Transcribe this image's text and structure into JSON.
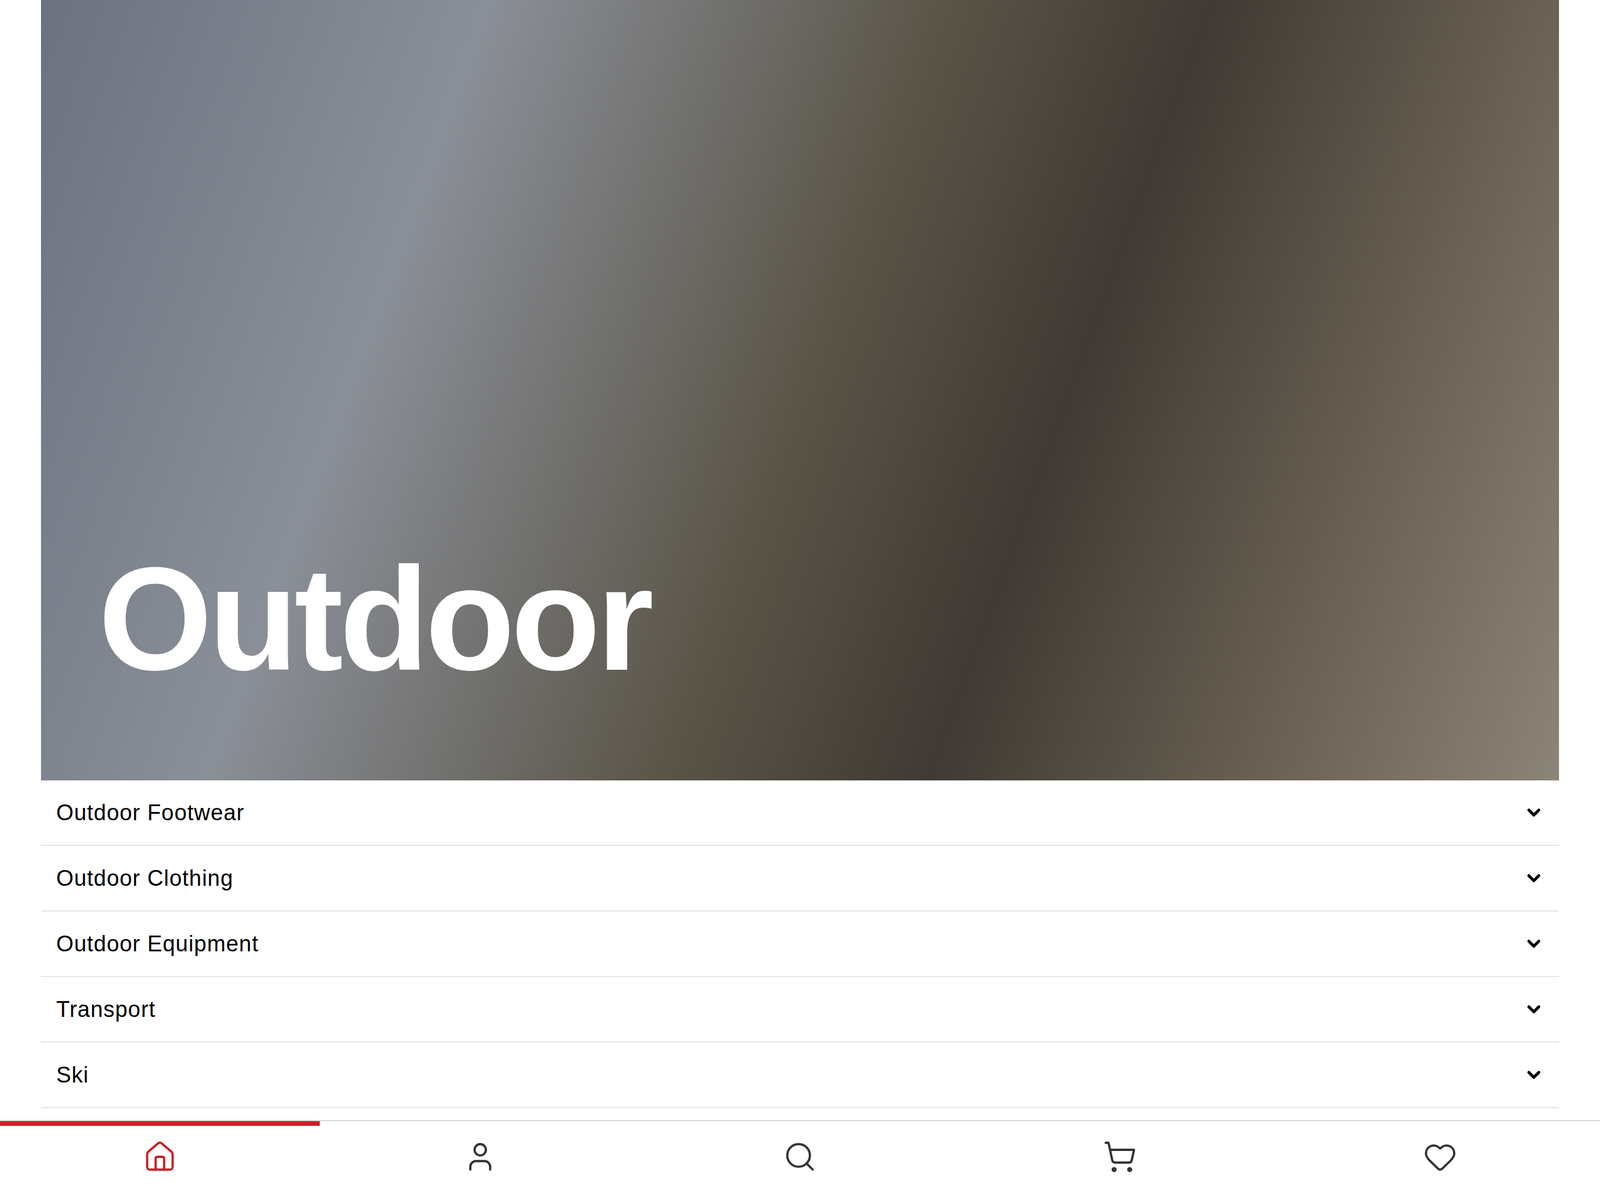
{
  "hero": {
    "title": "Outdoor"
  },
  "categories": [
    {
      "label": "Outdoor Footwear",
      "expanded": false
    },
    {
      "label": "Outdoor Clothing",
      "expanded": false
    },
    {
      "label": "Outdoor Equipment",
      "expanded": false
    },
    {
      "label": "Transport",
      "expanded": false
    },
    {
      "label": "Ski",
      "expanded": false
    }
  ],
  "bottom_nav": [
    {
      "selected": true
    },
    {
      "selected": false
    },
    {
      "selected": false
    },
    {
      "selected": false
    },
    {
      "selected": false
    }
  ]
}
